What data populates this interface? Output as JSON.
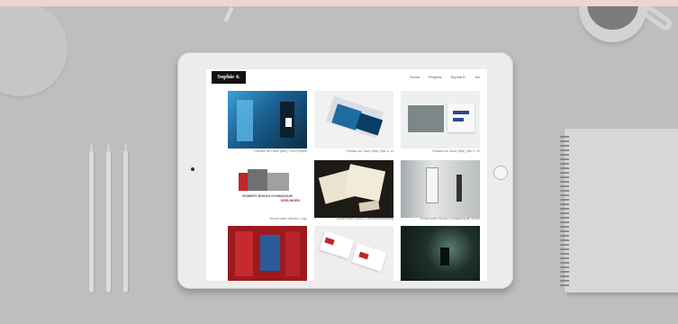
{
  "site": {
    "logo": "Sophie 4.",
    "menu": [
      "Home",
      "Projekts",
      "Sophie K.",
      "Art"
    ]
  },
  "gallery": [
    {
      "caption": "Potsdam der Dauer (Bild) | Foto Portpreis"
    },
    {
      "caption": "Potsdam der Dauer (Bild) | Bild 11-14"
    },
    {
      "caption": "Potsdam der Dauer (Bild) | Bild 17-19"
    },
    {
      "caption": "Schule hoffen Schulen | Logo",
      "logo_line1": "ROBERT BOSCH GYMNASIUM",
      "logo_line2": "GERLINGEN"
    },
    {
      "caption": "Schule hoffen Schule | Geschäftsausstattung"
    },
    {
      "caption": "Schule hoffen Schulen | Gestaltung der Schule"
    },
    {
      "caption": ""
    },
    {
      "caption": ""
    },
    {
      "caption": ""
    }
  ],
  "colors": {
    "background_pink": "#f2d3d3",
    "desk_gray": "#bdbebe",
    "accent_red": "#c0262c"
  }
}
